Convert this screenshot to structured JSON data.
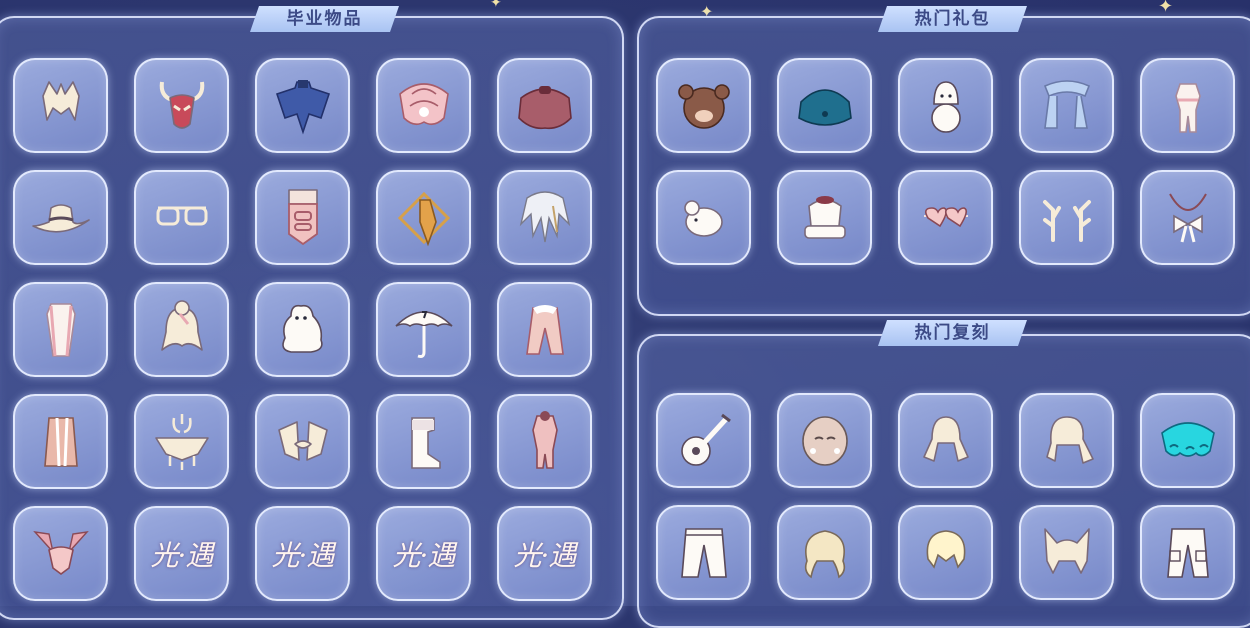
{
  "sections": {
    "graduation": {
      "title": "毕业物品"
    },
    "hot_packs": {
      "title": "热门礼包"
    },
    "hot_rerun": {
      "title": "热门复刻"
    }
  },
  "graduation_items": [
    {
      "icon": "white-hair-icon"
    },
    {
      "icon": "antler-mask-icon"
    },
    {
      "icon": "blue-cape-icon"
    },
    {
      "icon": "shell-cape-icon"
    },
    {
      "icon": "maroon-cape-icon"
    },
    {
      "icon": "cowboy-hat-icon"
    },
    {
      "icon": "glasses-icon"
    },
    {
      "icon": "lantern-prop-icon"
    },
    {
      "icon": "golden-scarf-icon"
    },
    {
      "icon": "feather-hair-icon"
    },
    {
      "icon": "white-dress-icon"
    },
    {
      "icon": "bun-hair-icon"
    },
    {
      "icon": "moomin-prop-icon"
    },
    {
      "icon": "umbrella-icon"
    },
    {
      "icon": "pink-coat-icon"
    },
    {
      "icon": "pink-cape-icon"
    },
    {
      "icon": "deer-mask-icon"
    },
    {
      "icon": "winged-hair-icon"
    },
    {
      "icon": "boots-icon"
    },
    {
      "icon": "pink-outfit-icon"
    },
    {
      "icon": "winged-mask-icon"
    },
    {
      "icon": "game-logo-icon",
      "text": "光·遇"
    },
    {
      "icon": "game-logo-icon",
      "text": "光·遇"
    },
    {
      "icon": "game-logo-icon",
      "text": "光·遇"
    },
    {
      "icon": "game-logo-icon",
      "text": "光·遇"
    }
  ],
  "hot_pack_items": [
    {
      "icon": "bear-hat-icon"
    },
    {
      "icon": "teal-cape-icon"
    },
    {
      "icon": "snowman-prop-icon"
    },
    {
      "icon": "blue-scarf-icon"
    },
    {
      "icon": "robe-outfit-icon"
    },
    {
      "icon": "mouse-prop-icon"
    },
    {
      "icon": "fur-hat-icon"
    },
    {
      "icon": "heart-glasses-icon"
    },
    {
      "icon": "antler-horns-icon"
    },
    {
      "icon": "bow-necklace-icon"
    }
  ],
  "hot_rerun_items": [
    {
      "icon": "guitar-icon"
    },
    {
      "icon": "round-mask-icon"
    },
    {
      "icon": "twin-tail-hair-icon"
    },
    {
      "icon": "side-tail-hair-icon"
    },
    {
      "icon": "cyan-cape-icon"
    },
    {
      "icon": "pants-icon"
    },
    {
      "icon": "curly-hair-icon"
    },
    {
      "icon": "short-hair-icon"
    },
    {
      "icon": "cat-ear-hair-icon"
    },
    {
      "icon": "cargo-pants-icon"
    }
  ],
  "colors": {
    "background": "#2f3a72",
    "panel_border": "#e1e8ff",
    "cell_fill": "#a3b4e6",
    "banner_fill": "#bcd2fa",
    "banner_text": "#3c4a86",
    "item_cream": "#f6ecd9",
    "item_pink": "#f0c9c4",
    "item_maroon": "#a85d6a"
  }
}
